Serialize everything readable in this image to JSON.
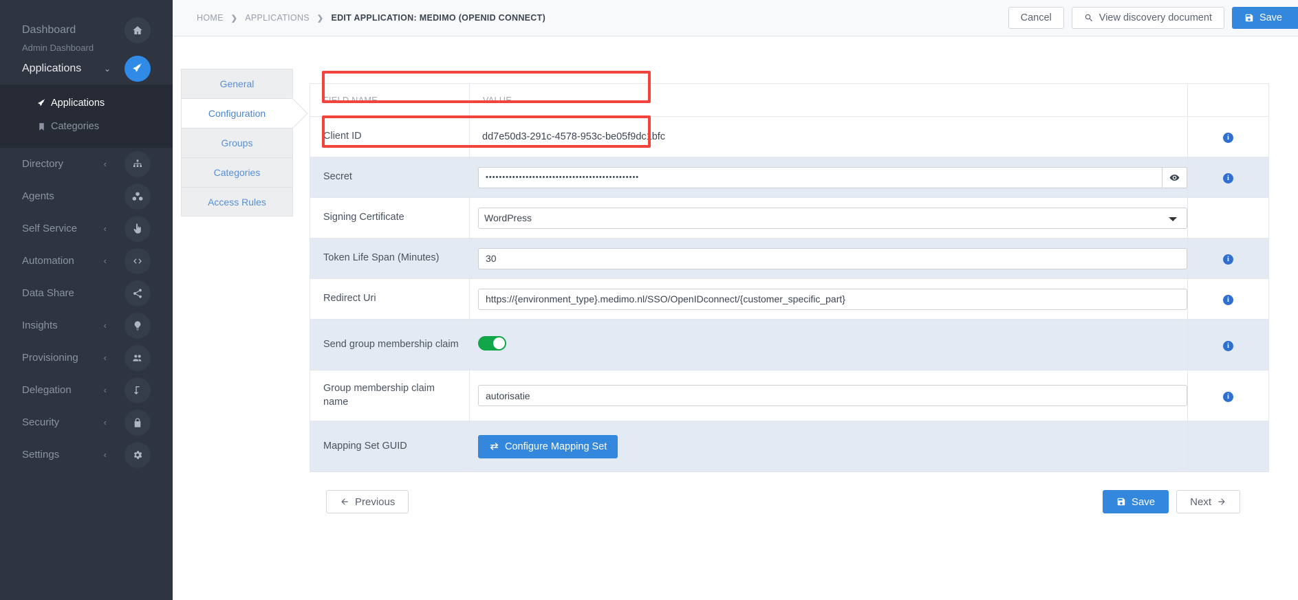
{
  "sidebar": {
    "dashboard": {
      "title": "Dashboard",
      "subtitle": "Admin Dashboard",
      "icon": "home-icon"
    },
    "applications_group": {
      "label": "Applications",
      "icon": "rocket-icon",
      "chevron": "⌄"
    },
    "subitems": [
      {
        "label": "Applications",
        "icon": "rocket-icon",
        "active": true
      },
      {
        "label": "Categories",
        "icon": "bookmark-icon",
        "active": false
      }
    ],
    "items": [
      {
        "label": "Directory",
        "arrow": "‹",
        "icon": "sitemap-icon"
      },
      {
        "label": "Agents",
        "arrow": "",
        "icon": "cubes-icon"
      },
      {
        "label": "Self Service",
        "arrow": "‹",
        "icon": "hand-pointer-icon"
      },
      {
        "label": "Automation",
        "arrow": "‹",
        "icon": "code-icon"
      },
      {
        "label": "Data Share",
        "arrow": "",
        "icon": "share-icon"
      },
      {
        "label": "Insights",
        "arrow": "‹",
        "icon": "lightbulb-icon"
      },
      {
        "label": "Provisioning",
        "arrow": "‹",
        "icon": "users-icon"
      },
      {
        "label": "Delegation",
        "arrow": "‹",
        "icon": "level-down-icon"
      },
      {
        "label": "Security",
        "arrow": "‹",
        "icon": "lock-icon"
      },
      {
        "label": "Settings",
        "arrow": "‹",
        "icon": "gear-icon"
      }
    ]
  },
  "topbar": {
    "breadcrumb": [
      {
        "label": "HOME",
        "current": false
      },
      {
        "label": "APPLICATIONS",
        "current": false
      },
      {
        "label": "EDIT APPLICATION: MEDIMO (OPENID CONNECT)",
        "current": true
      }
    ],
    "separator": "❯",
    "cancel_label": "Cancel",
    "discovery_label": "View discovery document",
    "save_label": "Save"
  },
  "wizard_tabs": [
    {
      "label": "General",
      "active": false
    },
    {
      "label": "Configuration",
      "active": true
    },
    {
      "label": "Groups",
      "active": false
    },
    {
      "label": "Categories",
      "active": false
    },
    {
      "label": "Access Rules",
      "active": false
    }
  ],
  "table": {
    "headers": {
      "field": "FIELD NAME",
      "value": "VALUE",
      "info": ""
    },
    "rows": [
      {
        "field": "Client ID",
        "type": "text",
        "value": "dd7e50d3-291c-4578-953c-be05f9dc1bfc",
        "info": true,
        "alt": false
      },
      {
        "field": "Secret",
        "type": "password",
        "value": "••••••••••••••••••••••••••••••••••••••••••••••",
        "info": true,
        "alt": true
      },
      {
        "field": "Signing Certificate",
        "type": "select",
        "value": "WordPress",
        "info": false,
        "alt": false
      },
      {
        "field": "Token Life Span (Minutes)",
        "type": "input",
        "value": "30",
        "info": true,
        "alt": true
      },
      {
        "field": "Redirect Uri",
        "type": "input",
        "value": "https://{environment_type}.medimo.nl/SSO/OpenIDconnect/{customer_specific_part}",
        "info": true,
        "alt": false
      },
      {
        "field": "Send group membership claim",
        "type": "toggle",
        "value": "on",
        "info": true,
        "alt": true
      },
      {
        "field": "Group membership claim name",
        "type": "input",
        "value": "autorisatie",
        "info": true,
        "alt": false
      },
      {
        "field": "Mapping Set GUID",
        "type": "button",
        "value": "Configure Mapping Set",
        "info": false,
        "alt": true
      }
    ]
  },
  "footer": {
    "previous_label": "Previous",
    "save_label": "Save",
    "next_label": "Next"
  },
  "colors": {
    "accent": "#3387dd",
    "sidebar_bg": "#2e3440",
    "highlight": "#f2443a",
    "toggle_on": "#11a647",
    "info": "#2f6fd0"
  }
}
